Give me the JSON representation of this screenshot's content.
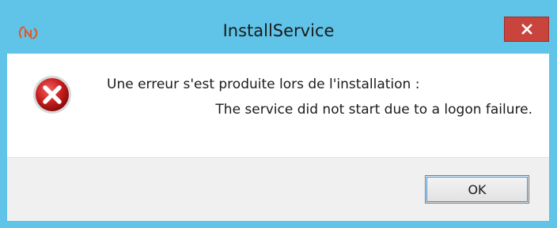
{
  "window": {
    "title": "InstallService",
    "close_icon": "close-icon",
    "app_icon": "app-icon",
    "accent_color": "#5fc4e8",
    "close_color": "#c8443c"
  },
  "message": {
    "icon": "error-icon",
    "line1": "Une erreur s'est produite lors de l'installation :",
    "line2": "The service did not start due to a logon failure."
  },
  "buttons": {
    "ok_label": "OK"
  }
}
